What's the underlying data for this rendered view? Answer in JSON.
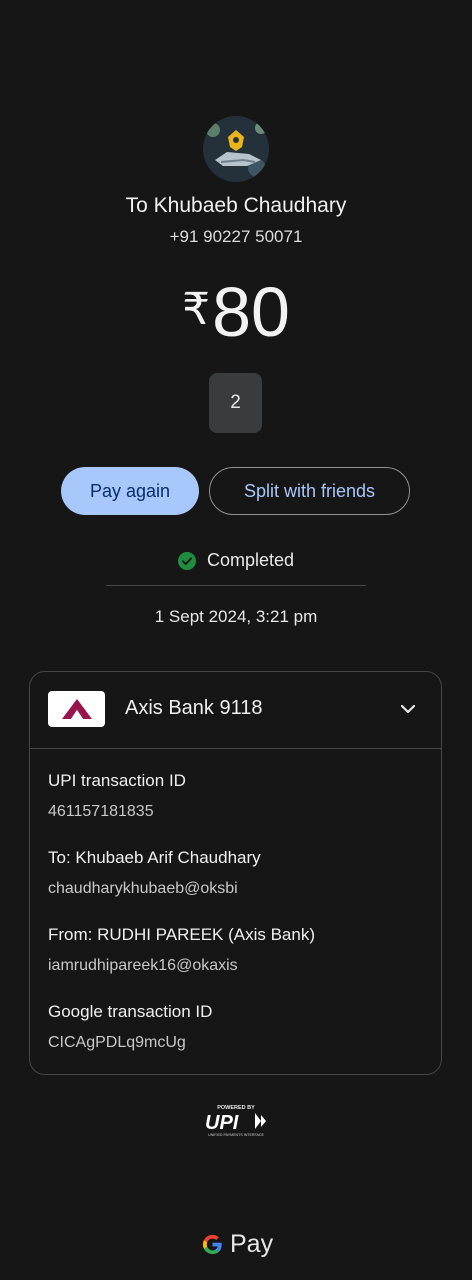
{
  "payee": {
    "title": "To Khubaeb Chaudhary",
    "phone": "+91 90227 50071"
  },
  "amount": {
    "currency": "₹",
    "value": "80"
  },
  "note_chip": "2",
  "actions": {
    "pay_again": "Pay again",
    "split": "Split with friends"
  },
  "status": {
    "label": "Completed",
    "color": "#1e8e3e"
  },
  "datetime": "1 Sept 2024, 3:21 pm",
  "account": {
    "bank_name": "Axis Bank 9118",
    "logo_color": "#97144d",
    "icon": "chevron-down-icon"
  },
  "details": [
    {
      "label": "UPI transaction ID",
      "value": "461157181835"
    },
    {
      "label": "To: Khubaeb Arif Chaudhary",
      "value": "chaudharykhubaeb@oksbi"
    },
    {
      "label": "From: RUDHI  PAREEK (Axis Bank)",
      "value": "iamrudhipareek16@okaxis"
    },
    {
      "label": "Google transaction ID",
      "value": "CICAgPDLq9mcUg"
    }
  ],
  "upi_badge": {
    "top": "POWERED BY",
    "word": "UPI",
    "bottom": "UNIFIED PAYMENTS INTERFACE"
  },
  "footer_brand": "Pay",
  "accent": "#a8c7fa"
}
